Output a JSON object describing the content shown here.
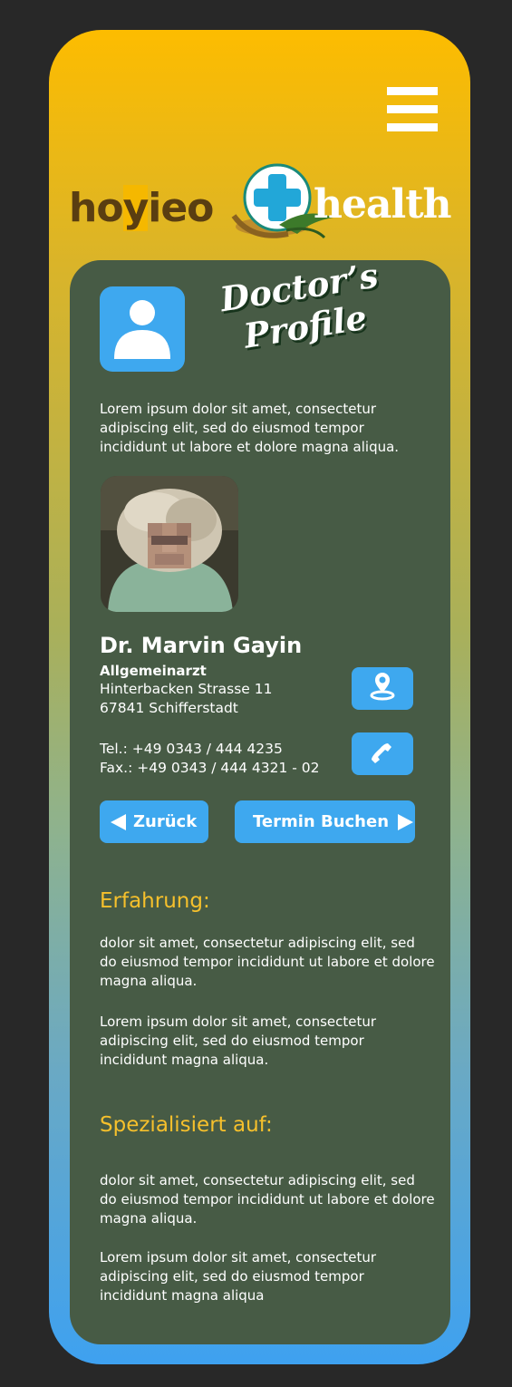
{
  "logo": {
    "left_text": "hoyieo",
    "left_prefix": "ho",
    "left_highlight": "y",
    "left_suffix": "ieo",
    "right_text": "health"
  },
  "profile": {
    "title_line1": "Doctor’s",
    "title_line2": "Profile",
    "intro": "Lorem ipsum dolor sit amet, consectetur adipiscing elit, sed do eiusmod tempor incididunt ut labore et dolore magna aliqua."
  },
  "doctor": {
    "name": "Dr. Marvin Gayin",
    "specialty": "Allgemeinarzt",
    "street": "Hinterbacken Strasse 11",
    "city": "67841 Schifferstadt",
    "tel": "Tel.: +49 0343 / 444 4235",
    "fax": "Fax.: +49 0343 / 444 4321 - 02"
  },
  "buttons": {
    "back": "Zurück",
    "book": "Termin Buchen"
  },
  "experience": {
    "heading": "Erfahrung:",
    "p1": "dolor sit amet, consectetur adipiscing elit, sed do eiusmod tempor incididunt ut labore et dolore magna aliqua.",
    "p2": "Lorem ipsum dolor sit amet, consectetur adipiscing elit, sed do eiusmod tempor incididunt magna aliqua."
  },
  "specialized": {
    "heading": "Spezialisiert auf:",
    "p1": "dolor sit amet, consectetur adipiscing elit, sed do eiusmod tempor incididunt ut labore et dolore magna aliqua.",
    "p2": "Lorem ipsum dolor sit amet, consectetur adipiscing elit, sed do eiusmod tempor incididunt magna aliqua"
  },
  "icons": {
    "menu": "hamburger-menu-icon",
    "user": "user-avatar-icon",
    "location": "location-pin-icon",
    "phone": "phone-icon",
    "back": "triangle-left-icon",
    "forward": "triangle-right-icon"
  },
  "colors": {
    "gradient_top": "#fdbc00",
    "gradient_bottom": "#3ea1f0",
    "card": "#475b45",
    "accent_blue": "#3ea8ef",
    "heading_yellow": "#f6c02c"
  }
}
